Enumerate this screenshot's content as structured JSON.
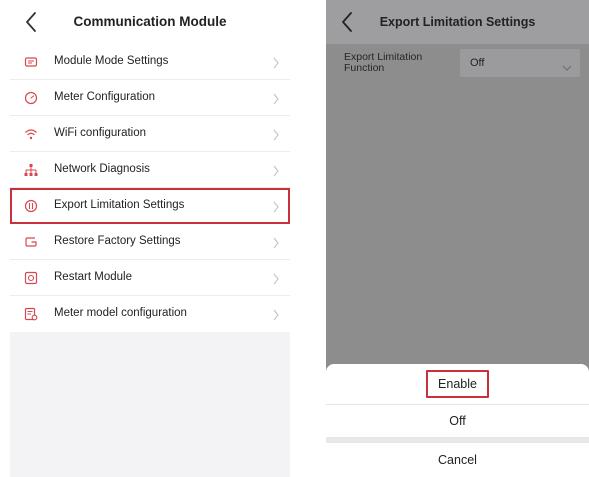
{
  "left_screen": {
    "title": "Communication Module",
    "menu": [
      {
        "label": "Module Mode Settings",
        "icon": "module-icon"
      },
      {
        "label": "Meter Configuration",
        "icon": "meter-icon"
      },
      {
        "label": "WiFi configuration",
        "icon": "wifi-icon"
      },
      {
        "label": "Network Diagnosis",
        "icon": "network-icon"
      },
      {
        "label": "Export Limitation Settings",
        "icon": "export-icon",
        "highlighted": true
      },
      {
        "label": "Restore Factory Settings",
        "icon": "restore-icon"
      },
      {
        "label": "Restart Module",
        "icon": "restart-icon"
      },
      {
        "label": "Meter model configuration",
        "icon": "meter-model-icon"
      }
    ]
  },
  "right_screen": {
    "title": "Export Limitation Settings",
    "field_label": "Export Limitation Function",
    "field_value": "Off",
    "sheet": {
      "enable_label": "Enable",
      "off_label": "Off",
      "cancel_label": "Cancel"
    }
  },
  "colors": {
    "accent": "#d8464e",
    "highlight_border": "#c8313b",
    "overlay": "#8d8d8e"
  }
}
